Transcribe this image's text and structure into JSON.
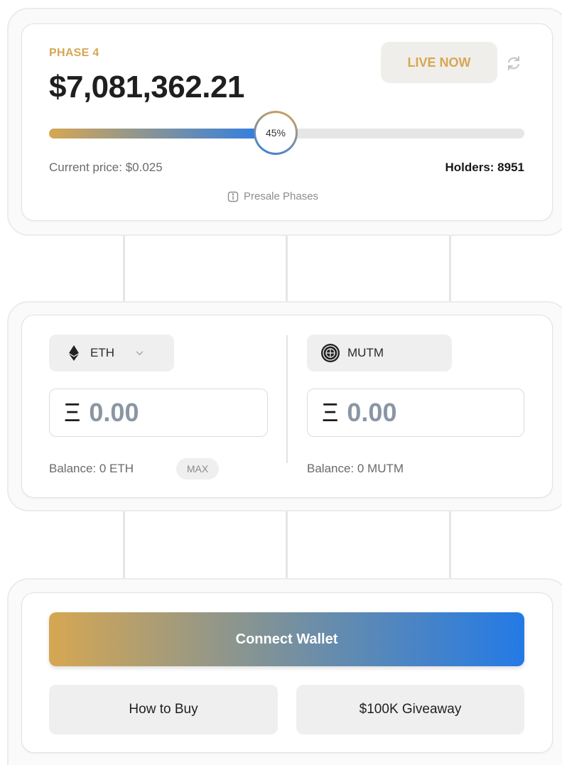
{
  "phase": {
    "label": "PHASE 4",
    "amount_raised": "$7,081,362.21",
    "status_badge": "LIVE NOW",
    "progress_percent": 45,
    "progress_label": "45%",
    "current_price": "Current price: $0.025",
    "holders": "Holders: 8951",
    "phases_link": "Presale Phases",
    "icons": {
      "refresh": "refresh-icon",
      "info": "info-icon"
    }
  },
  "swap": {
    "pay": {
      "token": "ETH",
      "token_icon": "ethereum-icon",
      "currency_symbol": "Ξ",
      "amount": "0.00",
      "balance": "Balance: 0 ETH",
      "max_label": "MAX"
    },
    "receive": {
      "token": "MUTM",
      "token_icon": "mutm-token-icon",
      "currency_symbol": "Ξ",
      "amount": "0.00",
      "balance": "Balance: 0 MUTM"
    }
  },
  "actions": {
    "connect_wallet": "Connect Wallet",
    "how_to_buy": "How to Buy",
    "giveaway": "$100K Giveaway"
  },
  "colors": {
    "gold": "#d6a752",
    "blue": "#237ae6",
    "muted_text": "#6a6a6a",
    "button_bg": "#efefef"
  }
}
